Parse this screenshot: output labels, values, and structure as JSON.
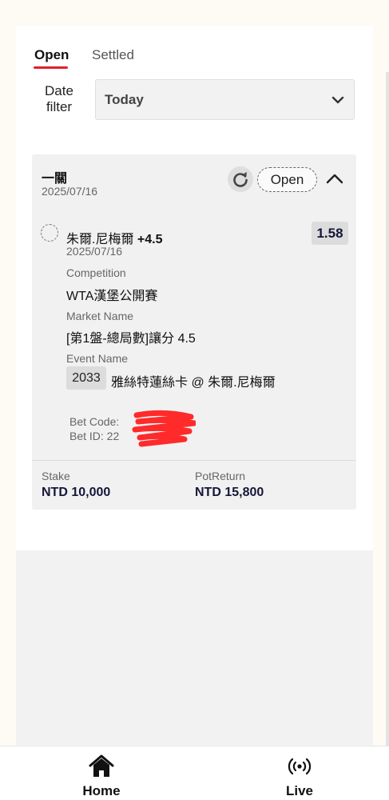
{
  "tabs": {
    "open_label": "Open",
    "settled_label": "Settled"
  },
  "date_filter": {
    "label": "Date filter",
    "value": "Today"
  },
  "bet": {
    "type": "一關",
    "date": "2025/07/16",
    "status": "Open",
    "leg": {
      "selection": "朱爾.尼梅爾",
      "handicap": "+4.5",
      "odds": "1.58",
      "date": "2025/07/16",
      "competition_label": "Competition",
      "competition": "WTA漢堡公開賽",
      "market_label": "Market Name",
      "market": "[第1盤-總局數]讓分 4.5",
      "event_label": "Event Name",
      "event_code": "2033",
      "event": "雅絲特蓮絲卡 @ 朱爾.尼梅爾"
    },
    "bet_code_label": "Bet Code:",
    "bet_id_label": "Bet ID: 22",
    "stake_label": "Stake",
    "stake": "NTD 10,000",
    "pot_return_label": "PotReturn",
    "pot_return": "NTD 15,800"
  },
  "nav": {
    "home_label": "Home",
    "live_label": "Live"
  },
  "colors": {
    "accent": "#e0232b",
    "odds_text": "#16163a",
    "redaction": "#ff2a2a"
  }
}
